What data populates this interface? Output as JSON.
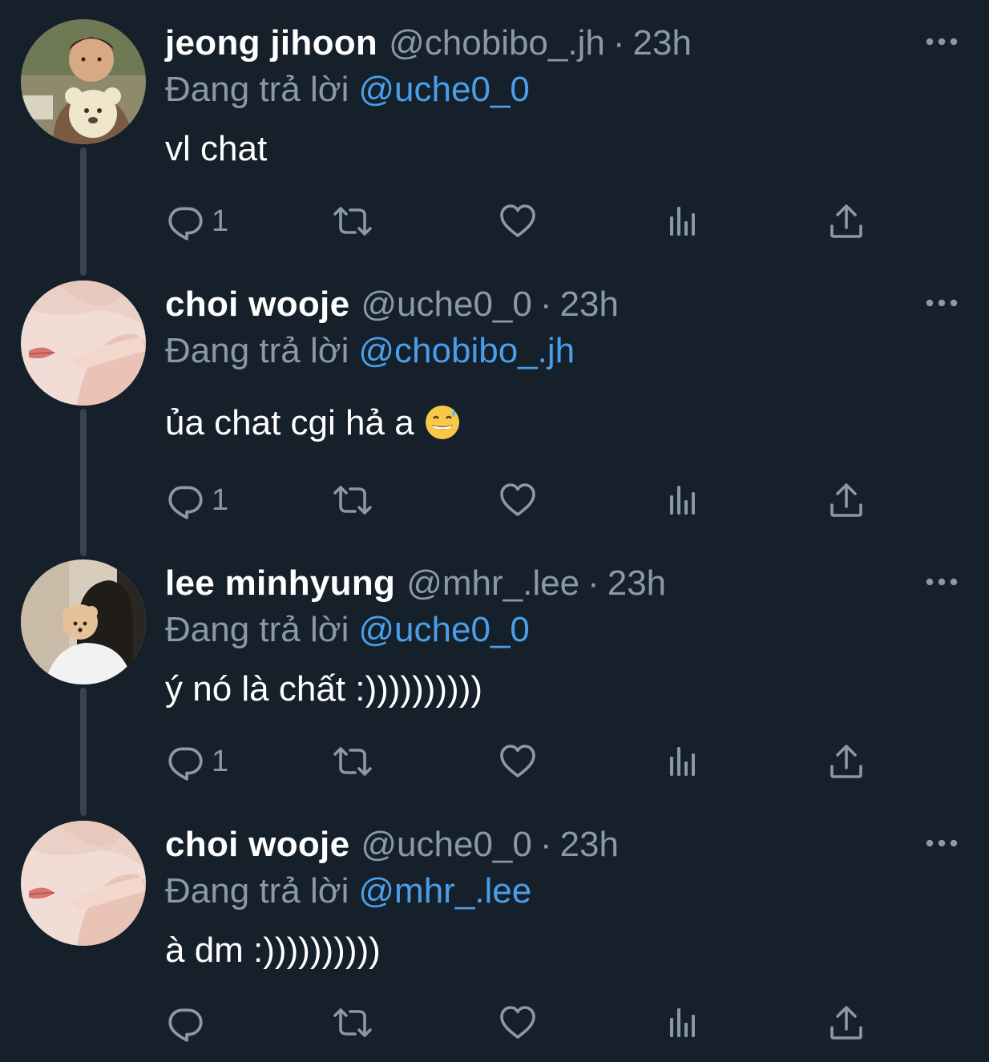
{
  "colors": {
    "background": "#15202b",
    "text_primary": "#ffffff",
    "text_secondary": "#8b98a5",
    "mention": "#4a9eea",
    "thread_line": "#38444d"
  },
  "reply_prefix": "Đang trả lời",
  "icons": {
    "reply": "reply-bubble-icon",
    "retweet": "retweet-icon",
    "like": "heart-icon",
    "views": "views-bar-chart-icon",
    "share": "share-icon",
    "more": "more-dots-icon",
    "emoji": "grinning-face-with-sweat-emoji"
  },
  "tweets": [
    {
      "display_name": "jeong jihoon",
      "handle": "@chobibo_.jh",
      "separator": "·",
      "time": "23h",
      "reply_to": "@uche0_0",
      "text": "vl chat",
      "reply_count": "1"
    },
    {
      "display_name": "choi wooje",
      "handle": "@uche0_0",
      "separator": "·",
      "time": "23h",
      "reply_to": "@chobibo_.jh",
      "text": "ủa chat cgi hả a",
      "reply_count": "1"
    },
    {
      "display_name": "lee minhyung",
      "handle": "@mhr_.lee",
      "separator": "·",
      "time": "23h",
      "reply_to": "@uche0_0",
      "text": "ý nó là chất :))))))))))",
      "reply_count": "1"
    },
    {
      "display_name": "choi wooje",
      "handle": "@uche0_0",
      "separator": "·",
      "time": "23h",
      "reply_to": "@mhr_.lee",
      "text": "à dm :))))))))))",
      "reply_count": ""
    }
  ]
}
